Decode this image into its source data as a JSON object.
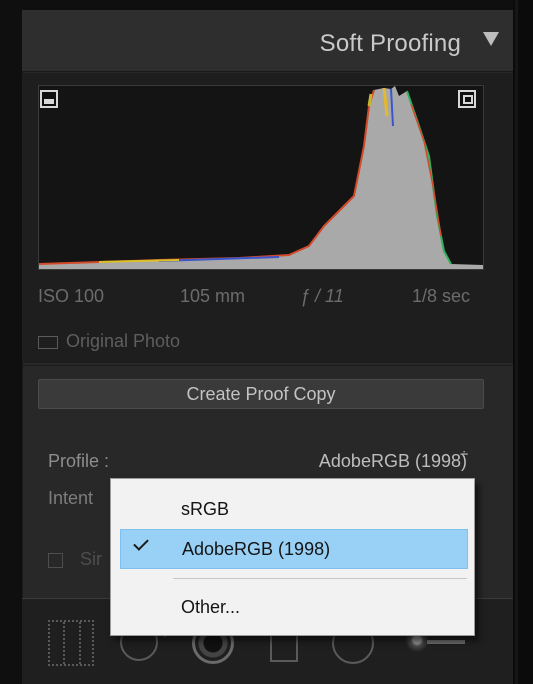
{
  "panel": {
    "title": "Soft Proofing"
  },
  "histogram": {
    "exif": {
      "iso": "ISO 100",
      "focal_length": "105 mm",
      "aperture": "ƒ / 11",
      "shutter": "1/8 sec"
    },
    "original_photo_label": "Original Photo"
  },
  "proof": {
    "create_button": "Create Proof Copy",
    "profile_label": "Profile :",
    "profile_value": "AdobeRGB (1998)",
    "profile_arrows": "÷",
    "intent_label": "Intent",
    "simulate_label": "Sir"
  },
  "menu": {
    "items": [
      {
        "label": "sRGB",
        "selected": false
      },
      {
        "label": "AdobeRGB (1998)",
        "selected": true
      },
      {
        "label": "Other...",
        "selected": false
      }
    ],
    "highlight_color": "#99d1f6"
  },
  "tools": [
    "grid-overlay-icon",
    "crop-icon",
    "spot-removal-icon",
    "graduated-filter-icon",
    "radial-filter-icon",
    "adjustment-brush-icon"
  ]
}
